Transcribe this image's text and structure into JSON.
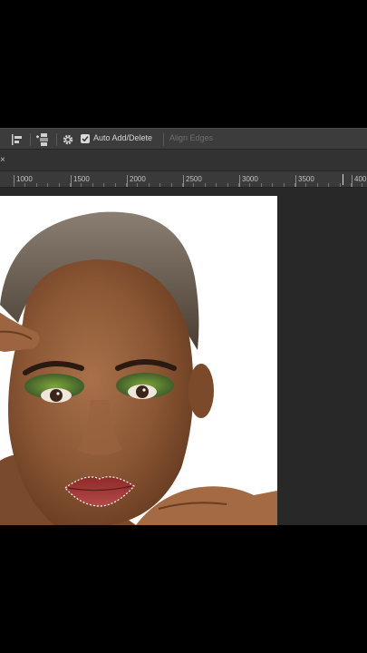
{
  "options_bar": {
    "auto_add_delete": {
      "label": "Auto Add/Delete",
      "checked": true
    },
    "align_edges": {
      "label": "Align Edges",
      "enabled": false
    }
  },
  "tab_strip": {
    "close_glyph": "×"
  },
  "ruler": {
    "ticks": [
      "1000",
      "1500",
      "2000",
      "2500",
      "3000",
      "3500",
      "400"
    ]
  },
  "icons": [
    "path-align-icon",
    "path-arrange-icon",
    "gear-icon",
    "checkbox-icon",
    "close-icon"
  ],
  "colors": {
    "ui_bg": "#2b2b2b",
    "options_bar": "#3c3c3c",
    "ruler": "#3a3a3a",
    "selection": "#ffffff"
  }
}
